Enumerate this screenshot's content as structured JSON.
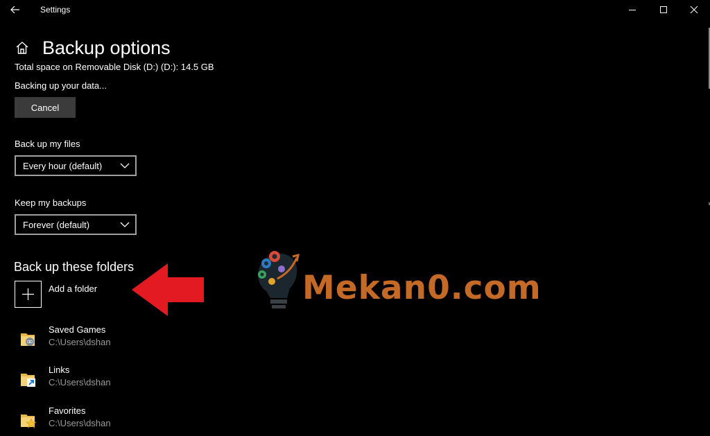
{
  "titlebar": {
    "app_title": "Settings"
  },
  "header": {
    "title": "Backup options",
    "space_info": "Total space on Removable Disk (D:) (D:): 14.5 GB",
    "status": "Backing up your data...",
    "cancel_label": "Cancel"
  },
  "backup_frequency": {
    "label": "Back up my files",
    "value": "Every hour (default)"
  },
  "keep_backups": {
    "label": "Keep my backups",
    "value": "Forever (default)"
  },
  "folders": {
    "section_title": "Back up these folders",
    "add_label": "Add a folder",
    "items": [
      {
        "name": "Saved Games",
        "path": "C:\\Users\\dshan",
        "icon": "saved-games-folder-icon"
      },
      {
        "name": "Links",
        "path": "C:\\Users\\dshan",
        "icon": "links-folder-icon"
      },
      {
        "name": "Favorites",
        "path": "C:\\Users\\dshan",
        "icon": "favorites-folder-icon"
      }
    ]
  },
  "watermark": {
    "text": "Mekan0.com",
    "color": "#c56a26"
  },
  "colors": {
    "background": "#000000",
    "button_bg": "#3b3b3b",
    "dropdown_border": "#a0a0a0",
    "path_text": "#9a9a9a",
    "arrow": "#e41a22"
  }
}
